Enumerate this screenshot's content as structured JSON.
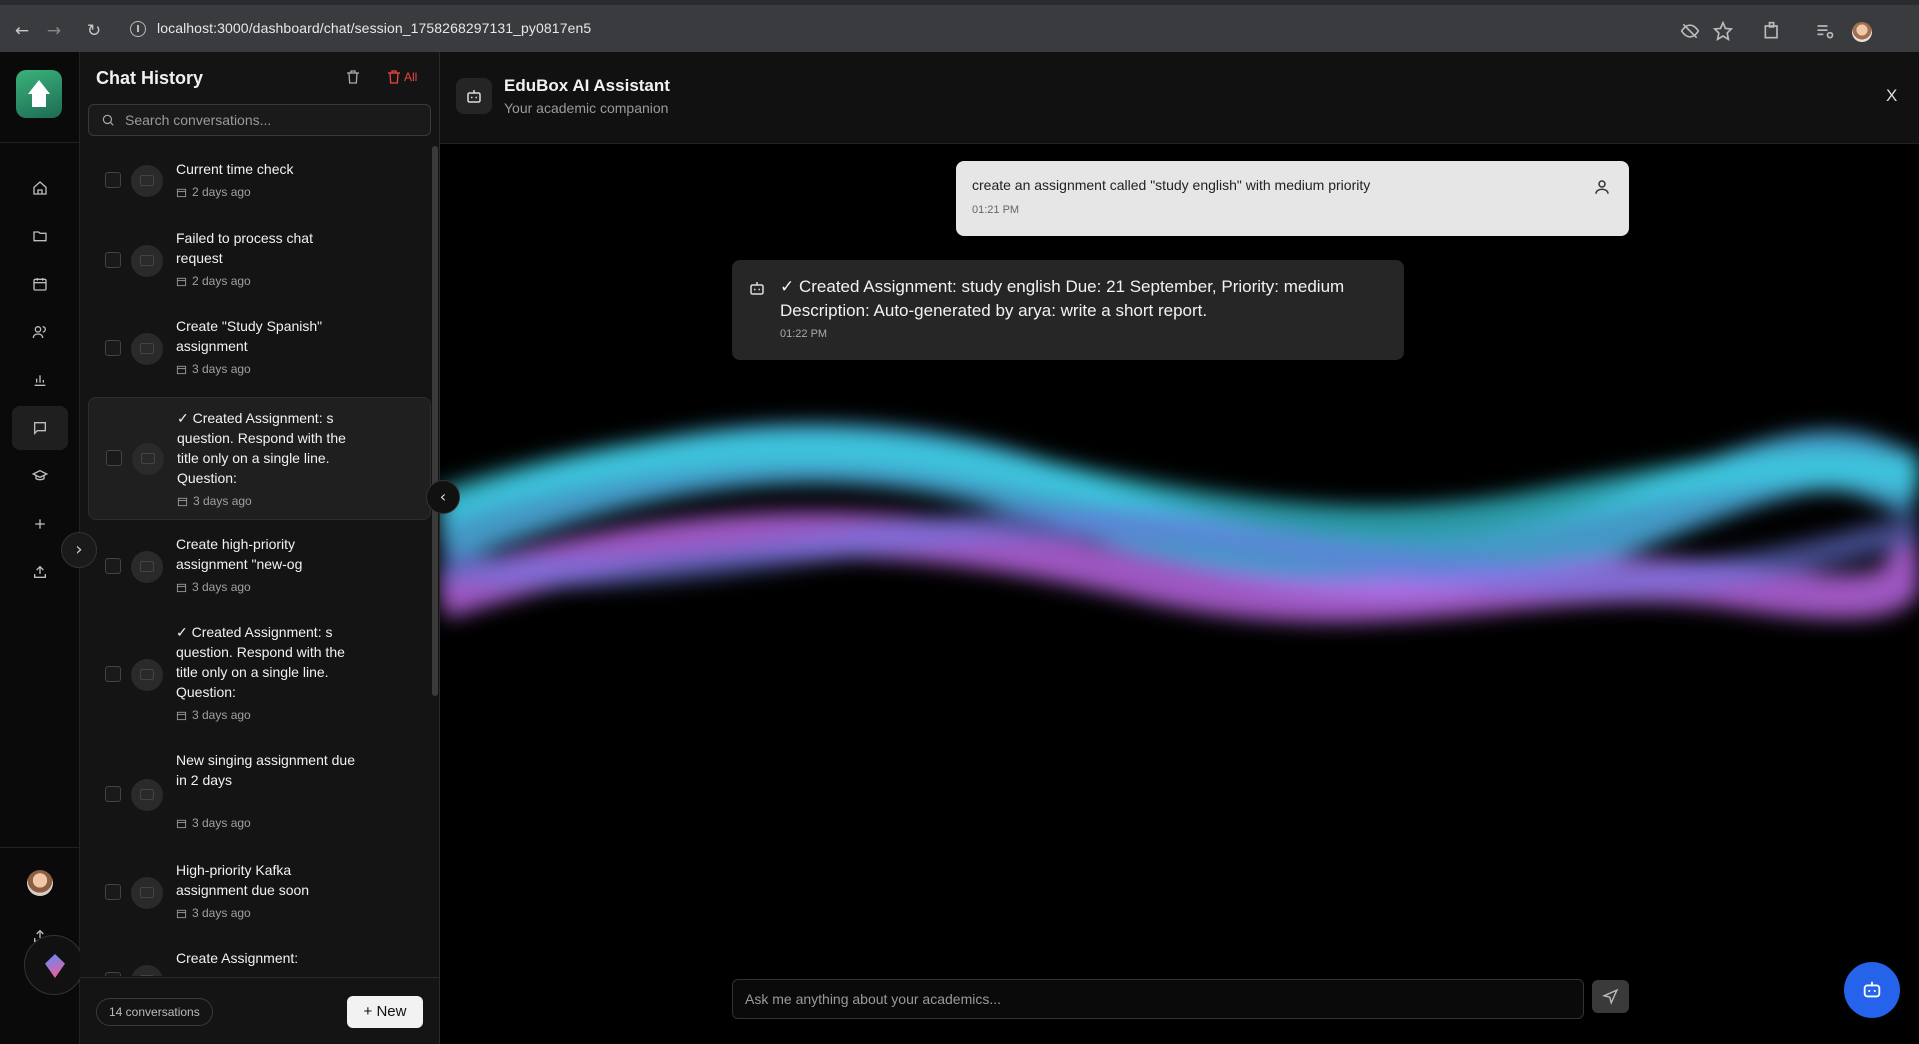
{
  "browser": {
    "url": "localhost:3000/dashboard/chat/session_1758268297131_py0817en5"
  },
  "history": {
    "title": "Chat History",
    "delete_all_label": "All",
    "search_placeholder": "Search conversations...",
    "items": [
      {
        "title": "Current time check",
        "date": "2 days ago",
        "selected": false
      },
      {
        "title": "Failed to process chat request",
        "date": "2 days ago",
        "selected": false
      },
      {
        "title": "Create \"Study Spanish\" assignment",
        "date": "3 days ago",
        "selected": false
      },
      {
        "title": "✓ Created Assignment: s question. Respond with the title only on a single line. Question:",
        "date": "3 days ago",
        "selected": true
      },
      {
        "title": "Create high-priority assignment \"new-og",
        "date": "3 days ago",
        "selected": false
      },
      {
        "title": "✓ Created Assignment: s question. Respond with the title only on a single line. Question:",
        "date": "3 days ago",
        "selected": false
      },
      {
        "title": "New singing assignment due in 2 days",
        "date": "3 days ago",
        "selected": false
      },
      {
        "title": "High-priority Kafka assignment due soon",
        "date": "3 days ago",
        "selected": false
      },
      {
        "title": "Create Assignment:",
        "date": "",
        "selected": false
      }
    ],
    "count_label": "14 conversations",
    "new_label": "New"
  },
  "assistant": {
    "title": "EduBox AI Assistant",
    "subtitle": "Your academic companion",
    "close_label": "X"
  },
  "messages": [
    {
      "role": "user",
      "text": "create an assignment called \"study english\" with medium priority",
      "time": "01:21 PM"
    },
    {
      "role": "assistant",
      "text": "✓ Created Assignment: study english Due: 21 September, Priority: medium Description: Auto-generated by arya: write a short report.",
      "time": "01:22 PM"
    }
  ],
  "composer": {
    "placeholder": "Ask me anything about your academics..."
  },
  "colors": {
    "accent_blue": "#2563eb",
    "danger_red": "#ef4444",
    "brand_green": "#2f9e6e",
    "wave_cyan": "#3bd6e6",
    "wave_purple": "#c46cf0"
  }
}
